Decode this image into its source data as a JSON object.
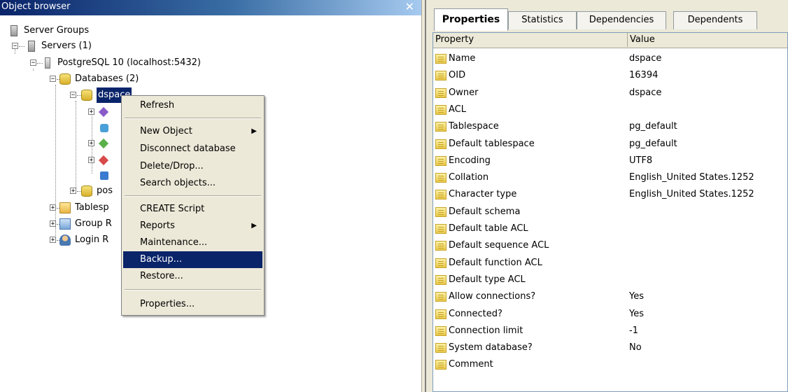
{
  "object_browser": {
    "title": "Object browser",
    "close_glyph": "✕",
    "tree": {
      "server_groups": "Server Groups",
      "servers": "Servers (1)",
      "postgres": "PostgreSQL 10 (localhost:5432)",
      "databases": "Databases (2)",
      "dspace": "dspace",
      "postgres_db": "pos",
      "tablespaces": "Tablesp",
      "group_roles": "Group R",
      "login_roles": "Login R"
    }
  },
  "context_menu": {
    "items": [
      {
        "label": "Refresh"
      },
      {
        "label": "New Object",
        "submenu": true
      },
      {
        "label": "Disconnect database"
      },
      {
        "label": "Delete/Drop..."
      },
      {
        "label": "Search objects..."
      },
      {
        "label": "CREATE Script"
      },
      {
        "label": "Reports",
        "submenu": true
      },
      {
        "label": "Maintenance..."
      },
      {
        "label": "Backup...",
        "highlighted": true
      },
      {
        "label": "Restore..."
      },
      {
        "label": "Properties..."
      }
    ],
    "arrow_glyph": "▶"
  },
  "properties_panel": {
    "tabs": [
      "Properties",
      "Statistics",
      "Dependencies",
      "Dependents"
    ],
    "active_tab": "Properties",
    "columns": {
      "property": "Property",
      "value": "Value"
    },
    "rows": [
      {
        "name": "Name",
        "value": "dspace"
      },
      {
        "name": "OID",
        "value": "16394"
      },
      {
        "name": "Owner",
        "value": "dspace"
      },
      {
        "name": "ACL",
        "value": ""
      },
      {
        "name": "Tablespace",
        "value": "pg_default"
      },
      {
        "name": "Default tablespace",
        "value": "pg_default"
      },
      {
        "name": "Encoding",
        "value": "UTF8"
      },
      {
        "name": "Collation",
        "value": "English_United States.1252"
      },
      {
        "name": "Character type",
        "value": "English_United States.1252"
      },
      {
        "name": "Default schema",
        "value": ""
      },
      {
        "name": "Default table ACL",
        "value": ""
      },
      {
        "name": "Default sequence ACL",
        "value": ""
      },
      {
        "name": "Default function ACL",
        "value": ""
      },
      {
        "name": "Default type ACL",
        "value": ""
      },
      {
        "name": "Allow connections?",
        "value": "Yes"
      },
      {
        "name": "Connected?",
        "value": "Yes"
      },
      {
        "name": "Connection limit",
        "value": "-1"
      },
      {
        "name": "System database?",
        "value": "No"
      },
      {
        "name": "Comment",
        "value": ""
      }
    ]
  },
  "colors": {
    "selection": "#0a246a",
    "title_gradient_start": "#0a246a",
    "title_gradient_end": "#a6caf0",
    "menu_background": "#ece9d8"
  }
}
